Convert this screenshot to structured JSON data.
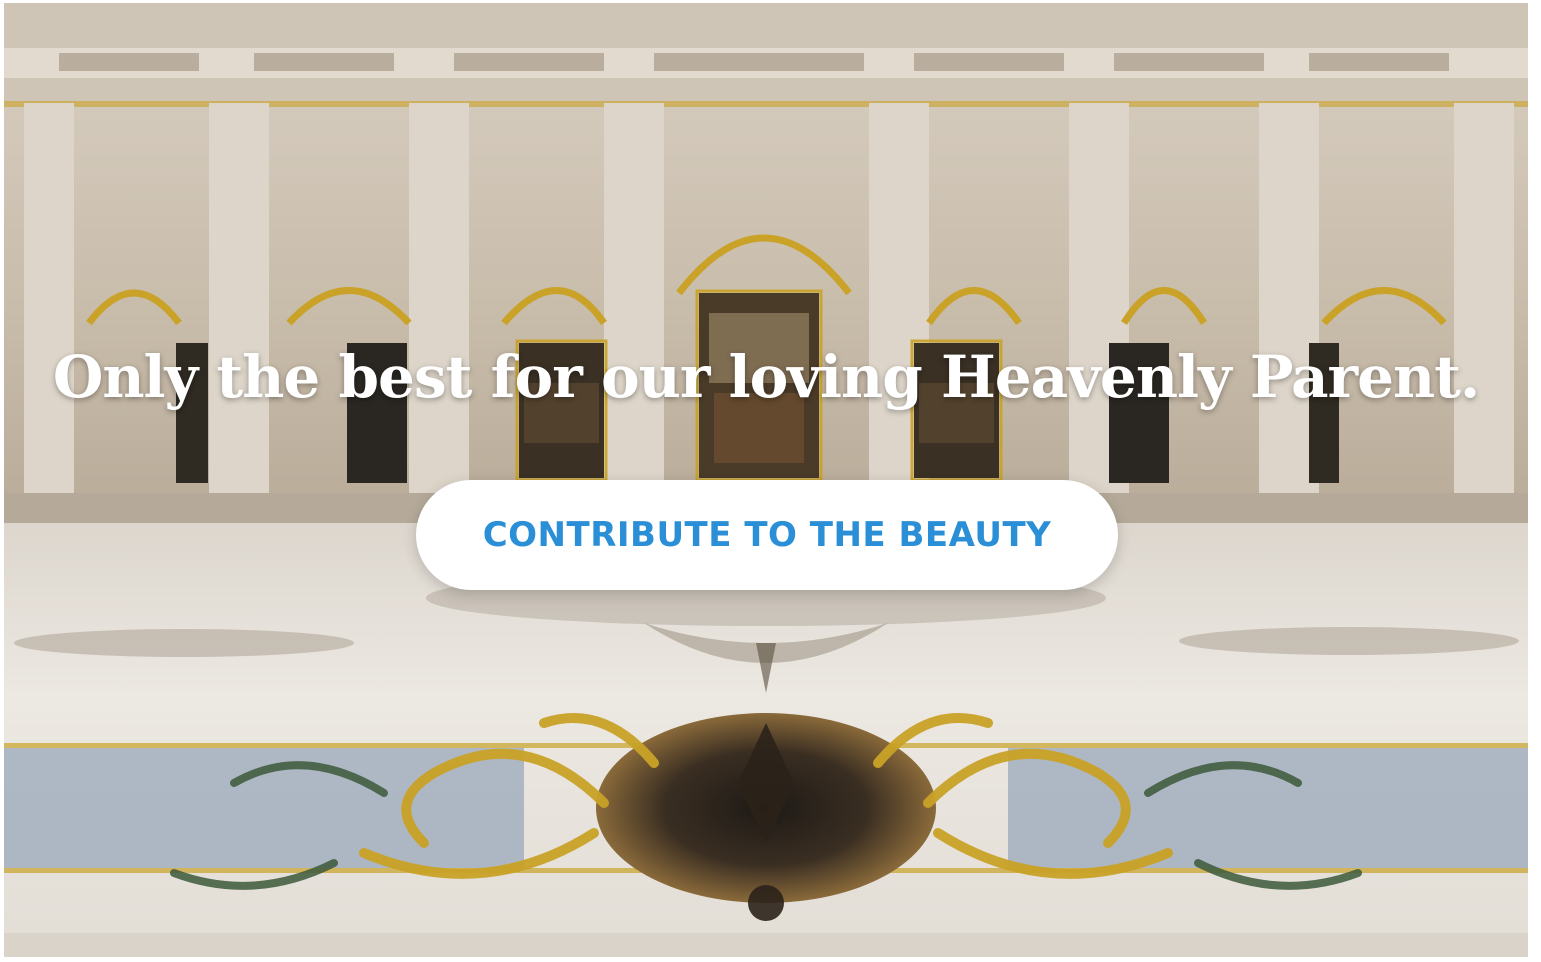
{
  "hero": {
    "headline": "Only the best for our loving Heavenly Parent.",
    "cta_label": "CONTRIBUTE TO THE BEAUTY",
    "background_image": "ornate-marble-hall-photo"
  },
  "colors": {
    "cta_text": "#2a8fd6",
    "cta_background": "#ffffff",
    "headline": "#ffffff",
    "gold_accent": "#c9a227",
    "marble": "#e8e3db"
  }
}
